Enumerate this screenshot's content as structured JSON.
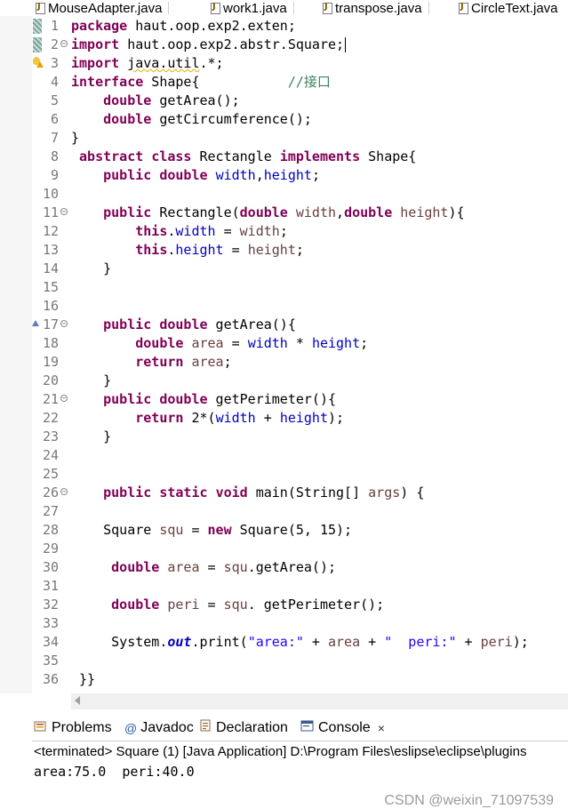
{
  "editor_tabs": [
    {
      "label": "MouseAdapter.java"
    },
    {
      "label": "work1.java"
    },
    {
      "label": "transpose.java"
    },
    {
      "label": "CircleText.java"
    }
  ],
  "code_lines": [
    {
      "num": "1",
      "html": "<span class=\"kw\">package</span> haut.oop.exp2.exten;"
    },
    {
      "num": "2",
      "html": "<span class=\"kw\">import</span> haut.oop.exp2.abstr.Square;<span class=\"caret\"></span>"
    },
    {
      "num": "3",
      "html": "<span class=\"kw\">import</span> <span class=\"squig\">java.util</span>.*;"
    },
    {
      "num": "4",
      "html": "<span class=\"kw\">interface</span> Shape{           <span class=\"cmt\">//接口</span>"
    },
    {
      "num": "5",
      "html": "    <span class=\"kw\">double</span> getArea();"
    },
    {
      "num": "6",
      "html": "    <span class=\"kw\">double</span> getCircumference();"
    },
    {
      "num": "7",
      "html": "}"
    },
    {
      "num": "8",
      "html": " <span class=\"kw\">abstract</span> <span class=\"kw\">class</span> Rectangle <span class=\"kw\">implements</span> Shape{"
    },
    {
      "num": "9",
      "html": "    <span class=\"kw\">public</span> <span class=\"kw\">double</span> <span class=\"fld\">width</span>,<span class=\"fld\">height</span>;"
    },
    {
      "num": "10",
      "html": ""
    },
    {
      "num": "11",
      "html": "    <span class=\"kw\">public</span> Rectangle(<span class=\"kw\">double</span> <span class=\"loc\">width</span>,<span class=\"kw\">double</span> <span class=\"loc\">height</span>){"
    },
    {
      "num": "12",
      "html": "        <span class=\"kw\">this</span>.<span class=\"fld\">width</span> = <span class=\"loc\">width</span>;"
    },
    {
      "num": "13",
      "html": "        <span class=\"kw\">this</span>.<span class=\"fld\">height</span> = <span class=\"loc\">height</span>;"
    },
    {
      "num": "14",
      "html": "    }"
    },
    {
      "num": "15",
      "html": ""
    },
    {
      "num": "16",
      "html": ""
    },
    {
      "num": "17",
      "html": "    <span class=\"kw\">public</span> <span class=\"kw\">double</span> getArea(){"
    },
    {
      "num": "18",
      "html": "        <span class=\"kw\">double</span> <span class=\"loc\">area</span> = <span class=\"fld\">width</span> * <span class=\"fld\">height</span>;"
    },
    {
      "num": "19",
      "html": "        <span class=\"kw\">return</span> <span class=\"loc\">area</span>;"
    },
    {
      "num": "20",
      "html": "    }"
    },
    {
      "num": "21",
      "html": "    <span class=\"kw\">public</span> <span class=\"kw\">double</span> getPerimeter(){"
    },
    {
      "num": "22",
      "html": "        <span class=\"kw\">return</span> 2*(<span class=\"fld\">width</span> + <span class=\"fld\">height</span>);"
    },
    {
      "num": "23",
      "html": "    }"
    },
    {
      "num": "24",
      "html": ""
    },
    {
      "num": "25",
      "html": ""
    },
    {
      "num": "26",
      "html": "    <span class=\"kw\">public</span> <span class=\"kw\">static</span> <span class=\"kw\">void</span> main(String[] <span class=\"loc\">args</span>) {"
    },
    {
      "num": "27",
      "html": ""
    },
    {
      "num": "28",
      "html": "    Square <span class=\"loc\">squ</span> = <span class=\"kw\">new</span> Square(5, 15);"
    },
    {
      "num": "29",
      "html": ""
    },
    {
      "num": "30",
      "html": "     <span class=\"kw\">double</span> <span class=\"loc\">area</span> = <span class=\"loc\">squ</span>.getArea();"
    },
    {
      "num": "31",
      "html": ""
    },
    {
      "num": "32",
      "html": "     <span class=\"kw\">double</span> <span class=\"loc\">peri</span> = <span class=\"loc\">squ</span>. getPerimeter();"
    },
    {
      "num": "33",
      "html": ""
    },
    {
      "num": "34",
      "html": "     System.<span class=\"sfld\">out</span>.print(<span class=\"str\">\"area:\"</span> + <span class=\"loc\">area</span> + <span class=\"str\">\"  peri:\"</span> + <span class=\"loc\">peri</span>);"
    },
    {
      "num": "35",
      "html": ""
    },
    {
      "num": "36",
      "html": " }}"
    }
  ],
  "views": {
    "tabs": [
      {
        "label": "Problems",
        "icon": "problems-icon"
      },
      {
        "label": "Javadoc",
        "icon": "at-icon"
      },
      {
        "label": "Declaration",
        "icon": "declaration-icon"
      },
      {
        "label": "Console",
        "icon": "console-icon"
      }
    ],
    "close_glyph": "×",
    "console_status": "<terminated> Square (1) [Java Application] D:\\Program Files\\eslipse\\eclipse\\plugins",
    "console_output": "area:75.0  peri:40.0"
  },
  "watermark": "CSDN @weixin_71097539",
  "colors": {
    "keyword": "#7f0055",
    "field": "#0000c0",
    "string": "#2a00ff",
    "comment": "#3f7f5f"
  }
}
